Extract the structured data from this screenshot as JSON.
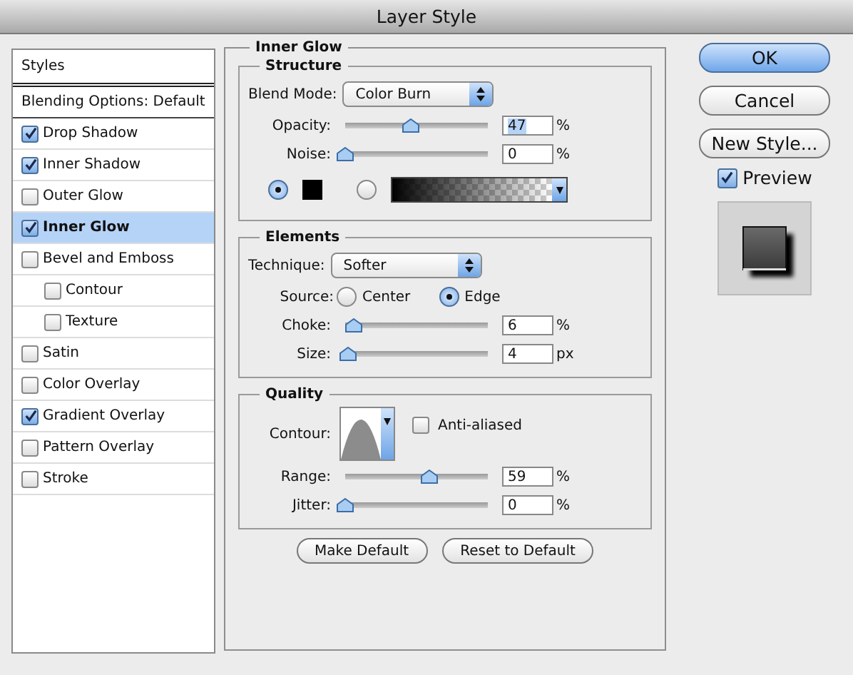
{
  "window": {
    "title": "Layer Style"
  },
  "styles_list": {
    "header": "Styles",
    "items": [
      {
        "label": "Blending Options: Default",
        "kind": "plain",
        "selected": false
      },
      {
        "label": "Drop Shadow",
        "kind": "check",
        "checked": true,
        "selected": false
      },
      {
        "label": "Inner Shadow",
        "kind": "check",
        "checked": true,
        "selected": false
      },
      {
        "label": "Outer Glow",
        "kind": "check",
        "checked": false,
        "selected": false
      },
      {
        "label": "Inner Glow",
        "kind": "check",
        "checked": true,
        "selected": true
      },
      {
        "label": "Bevel and Emboss",
        "kind": "check",
        "checked": false,
        "selected": false,
        "children": [
          {
            "label": "Contour",
            "kind": "check",
            "checked": false,
            "selected": false
          },
          {
            "label": "Texture",
            "kind": "check",
            "checked": false,
            "selected": false
          }
        ]
      },
      {
        "label": "Satin",
        "kind": "check",
        "checked": false,
        "selected": false
      },
      {
        "label": "Color Overlay",
        "kind": "check",
        "checked": false,
        "selected": false
      },
      {
        "label": "Gradient Overlay",
        "kind": "check",
        "checked": true,
        "selected": false
      },
      {
        "label": "Pattern Overlay",
        "kind": "check",
        "checked": false,
        "selected": false
      },
      {
        "label": "Stroke",
        "kind": "check",
        "checked": false,
        "selected": false
      }
    ]
  },
  "panel": {
    "title": "Inner Glow",
    "sections": [
      {
        "title": "Structure",
        "rows": [
          {
            "kind": "dropdown",
            "label": "Blend Mode:",
            "value": "Color Burn"
          },
          {
            "kind": "slider",
            "label": "Opacity:",
            "level": 0.46,
            "value": "47",
            "unit": "%",
            "highlighted": true
          },
          {
            "kind": "slider",
            "label": "Noise:",
            "level": 0,
            "value": "0",
            "unit": "%",
            "highlighted": false
          },
          {
            "kind": "fill",
            "options": [
              {
                "kind": "color",
                "selected": true
              },
              {
                "kind": "gradient",
                "selected": false
              }
            ]
          }
        ]
      },
      {
        "title": "Elements",
        "rows": [
          {
            "kind": "dropdown",
            "label": "Technique:",
            "value": "Softer"
          },
          {
            "kind": "radios",
            "label": "Source:",
            "options": [
              {
                "label": "Center",
                "selected": false
              },
              {
                "label": "Edge",
                "selected": true
              }
            ]
          },
          {
            "kind": "slider",
            "label": "Choke:",
            "level": 0.06,
            "value": "6",
            "unit": "%",
            "highlighted": false
          },
          {
            "kind": "slider",
            "label": "Size:",
            "level": 0.02,
            "value": "4",
            "unit": "px",
            "highlighted": false
          }
        ]
      },
      {
        "title": "Quality",
        "rows": [
          {
            "kind": "contour",
            "label": "Contour:",
            "checkbox": {
              "label": "Anti-aliased",
              "checked": false
            }
          },
          {
            "kind": "slider",
            "label": "Range:",
            "level": 0.59,
            "value": "59",
            "unit": "%",
            "highlighted": false
          },
          {
            "kind": "slider",
            "label": "Jitter:",
            "level": 0,
            "value": "0",
            "unit": "%",
            "highlighted": false
          }
        ]
      }
    ],
    "buttons": [
      "Make Default",
      "Reset to Default"
    ]
  },
  "actions": [
    {
      "label": "OK",
      "default": true
    },
    {
      "label": "Cancel",
      "default": false
    },
    {
      "label": "New Style...",
      "default": false
    }
  ],
  "preview": {
    "label": "Preview",
    "checked": true
  }
}
